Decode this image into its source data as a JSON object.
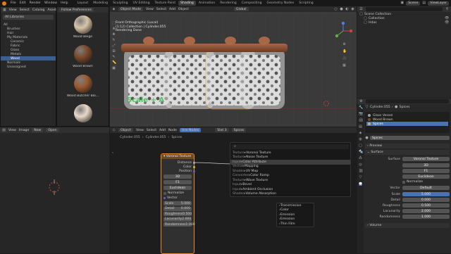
{
  "topbar": {
    "menus": [
      "File",
      "Edit",
      "Render",
      "Window",
      "Help"
    ],
    "workspaces": [
      "Layout",
      "Modeling",
      "Sculpting",
      "UV Editing",
      "Texture Paint",
      "Shading",
      "Animation",
      "Rendering",
      "Compositing",
      "Geometry Nodes",
      "Scripting"
    ],
    "active_workspace": "Shading",
    "scene": "Scene",
    "view_layer": "ViewLayer"
  },
  "asset_browser": {
    "header": [
      "View",
      "Select",
      "Catalog",
      "Asset"
    ],
    "library_select": "All Libraries",
    "import_select": "Follow Preferences",
    "tree": [
      {
        "label": "All",
        "indent": 0,
        "sel": false
      },
      {
        "label": "Brushes",
        "indent": 1,
        "sel": false
      },
      {
        "label": "Hair",
        "indent": 1,
        "sel": false
      },
      {
        "label": "My Materials",
        "indent": 1,
        "sel": false
      },
      {
        "label": "Ceramic",
        "indent": 2,
        "sel": false
      },
      {
        "label": "Fabric",
        "indent": 2,
        "sel": false
      },
      {
        "label": "Glass",
        "indent": 2,
        "sel": false
      },
      {
        "label": "Metals",
        "indent": 2,
        "sel": false
      },
      {
        "label": "Wood",
        "indent": 2,
        "sel": true
      },
      {
        "label": "Normals",
        "indent": 1,
        "sel": false
      },
      {
        "label": "Unassigned",
        "indent": 1,
        "sel": false
      }
    ],
    "assets": [
      {
        "name": "Wood Beige",
        "color": "#d8c4a8"
      },
      {
        "name": "Wood Brown",
        "color": "#7a4a2c"
      },
      {
        "name": "Wood Butcher Blo...",
        "color": "#9b5a30"
      },
      {
        "name": "",
        "color": "#e8d8c8"
      }
    ]
  },
  "viewport": {
    "mode": "Object Mode",
    "menus": [
      "View",
      "Select",
      "Add",
      "Object"
    ],
    "transform": "Global",
    "overlay_lines": [
      "Front Orthographic (Local)",
      "(1:12) Collection | Cylinder.055",
      "Rendering Done"
    ],
    "watermark": "Scale + A"
  },
  "image_editor": {
    "menus": [
      "View",
      "Image"
    ],
    "new_btn": "New",
    "open_btn": "Open"
  },
  "node_editor": {
    "type": "Object",
    "menus": [
      "View",
      "Select",
      "Add",
      "Node"
    ],
    "use_nodes": "Use Nodes",
    "slot": "Slot 3",
    "material": "Spices",
    "breadcrumb": [
      "Cylinder.055",
      "Cylinder.055",
      "Spices"
    ],
    "voronoi": {
      "title": "Voronoi Texture",
      "outputs": [
        "Distance",
        "Color",
        "Position"
      ],
      "dim": "3D",
      "feature": "F1",
      "metric": "Euclidean",
      "normalize": "Normalize",
      "vector": "Vector",
      "fields": [
        {
          "label": "Scale",
          "value": "5.000"
        },
        {
          "label": "Detail",
          "value": "0.000"
        },
        {
          "label": "Roughness",
          "value": "0.500"
        },
        {
          "label": "Lacunarity",
          "value": "2.000"
        },
        {
          "label": "Randomness",
          "value": "1.000"
        }
      ]
    },
    "search": {
      "query": "",
      "results": [
        {
          "cat": "Texture",
          "name": "Voronoi Texture"
        },
        {
          "cat": "Texture",
          "name": "Noise Texture"
        },
        {
          "cat": "Input",
          "name": "Color Attribute"
        },
        {
          "cat": "Vector",
          "name": "Mapping"
        },
        {
          "cat": "Shader",
          "name": "UV Map"
        },
        {
          "cat": "Converter",
          "name": "Color Ramp"
        },
        {
          "cat": "Texture",
          "name": "Wave Texture"
        },
        {
          "cat": "Input",
          "name": "Bevel"
        },
        {
          "cat": "Input",
          "name": "Ambient Occlusion"
        },
        {
          "cat": "Shader",
          "name": "Volume Absorption"
        }
      ],
      "highlight_index": 2
    },
    "submenu": [
      "Transmission",
      "Color",
      "Emission",
      "Emission",
      "Thin Film"
    ]
  },
  "outliner": {
    "items": [
      {
        "label": "Scene Collection",
        "indent": 0
      },
      {
        "label": "Collection",
        "indent": 1
      },
      {
        "label": "Hdas",
        "indent": 1
      }
    ]
  },
  "properties": {
    "object": "Cylinder.055",
    "material": "Spices",
    "slots": [
      {
        "label": "Glass Vessel",
        "color": "#a0a0a0",
        "sel": false
      },
      {
        "label": "Wood Brown",
        "color": "#7a4a2c",
        "sel": false
      },
      {
        "label": "Spices",
        "color": "#d0b070",
        "sel": true
      }
    ],
    "mat_name": "Spices",
    "sections": [
      "Preview",
      "Surface"
    ],
    "surface": "Voronoi Texture",
    "dim": "3D",
    "feature": "F1",
    "metric": "Euclidean",
    "normalize": "Normalize",
    "vector": "Default",
    "fields": [
      {
        "label": "Scale",
        "value": "5.000"
      },
      {
        "label": "Detail",
        "value": "0.000"
      },
      {
        "label": "Roughness",
        "value": "0.500"
      },
      {
        "label": "Lacunarity",
        "value": "2.000"
      },
      {
        "label": "Randomness",
        "value": "1.000"
      }
    ],
    "volume": "Volume"
  }
}
